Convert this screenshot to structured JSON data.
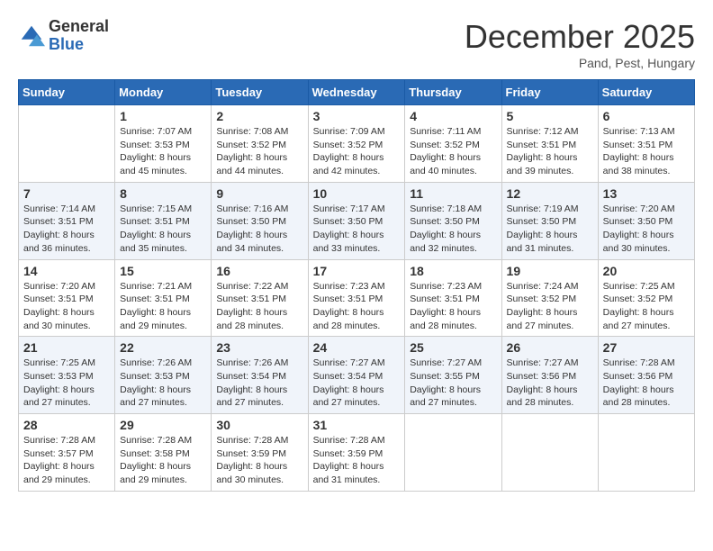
{
  "logo": {
    "general": "General",
    "blue": "Blue"
  },
  "title": "December 2025",
  "location": "Pand, Pest, Hungary",
  "days_header": [
    "Sunday",
    "Monday",
    "Tuesday",
    "Wednesday",
    "Thursday",
    "Friday",
    "Saturday"
  ],
  "weeks": [
    [
      {
        "day": "",
        "info": ""
      },
      {
        "day": "1",
        "info": "Sunrise: 7:07 AM\nSunset: 3:53 PM\nDaylight: 8 hours\nand 45 minutes."
      },
      {
        "day": "2",
        "info": "Sunrise: 7:08 AM\nSunset: 3:52 PM\nDaylight: 8 hours\nand 44 minutes."
      },
      {
        "day": "3",
        "info": "Sunrise: 7:09 AM\nSunset: 3:52 PM\nDaylight: 8 hours\nand 42 minutes."
      },
      {
        "day": "4",
        "info": "Sunrise: 7:11 AM\nSunset: 3:52 PM\nDaylight: 8 hours\nand 40 minutes."
      },
      {
        "day": "5",
        "info": "Sunrise: 7:12 AM\nSunset: 3:51 PM\nDaylight: 8 hours\nand 39 minutes."
      },
      {
        "day": "6",
        "info": "Sunrise: 7:13 AM\nSunset: 3:51 PM\nDaylight: 8 hours\nand 38 minutes."
      }
    ],
    [
      {
        "day": "7",
        "info": "Sunrise: 7:14 AM\nSunset: 3:51 PM\nDaylight: 8 hours\nand 36 minutes."
      },
      {
        "day": "8",
        "info": "Sunrise: 7:15 AM\nSunset: 3:51 PM\nDaylight: 8 hours\nand 35 minutes."
      },
      {
        "day": "9",
        "info": "Sunrise: 7:16 AM\nSunset: 3:50 PM\nDaylight: 8 hours\nand 34 minutes."
      },
      {
        "day": "10",
        "info": "Sunrise: 7:17 AM\nSunset: 3:50 PM\nDaylight: 8 hours\nand 33 minutes."
      },
      {
        "day": "11",
        "info": "Sunrise: 7:18 AM\nSunset: 3:50 PM\nDaylight: 8 hours\nand 32 minutes."
      },
      {
        "day": "12",
        "info": "Sunrise: 7:19 AM\nSunset: 3:50 PM\nDaylight: 8 hours\nand 31 minutes."
      },
      {
        "day": "13",
        "info": "Sunrise: 7:20 AM\nSunset: 3:50 PM\nDaylight: 8 hours\nand 30 minutes."
      }
    ],
    [
      {
        "day": "14",
        "info": "Sunrise: 7:20 AM\nSunset: 3:51 PM\nDaylight: 8 hours\nand 30 minutes."
      },
      {
        "day": "15",
        "info": "Sunrise: 7:21 AM\nSunset: 3:51 PM\nDaylight: 8 hours\nand 29 minutes."
      },
      {
        "day": "16",
        "info": "Sunrise: 7:22 AM\nSunset: 3:51 PM\nDaylight: 8 hours\nand 28 minutes."
      },
      {
        "day": "17",
        "info": "Sunrise: 7:23 AM\nSunset: 3:51 PM\nDaylight: 8 hours\nand 28 minutes."
      },
      {
        "day": "18",
        "info": "Sunrise: 7:23 AM\nSunset: 3:51 PM\nDaylight: 8 hours\nand 28 minutes."
      },
      {
        "day": "19",
        "info": "Sunrise: 7:24 AM\nSunset: 3:52 PM\nDaylight: 8 hours\nand 27 minutes."
      },
      {
        "day": "20",
        "info": "Sunrise: 7:25 AM\nSunset: 3:52 PM\nDaylight: 8 hours\nand 27 minutes."
      }
    ],
    [
      {
        "day": "21",
        "info": "Sunrise: 7:25 AM\nSunset: 3:53 PM\nDaylight: 8 hours\nand 27 minutes."
      },
      {
        "day": "22",
        "info": "Sunrise: 7:26 AM\nSunset: 3:53 PM\nDaylight: 8 hours\nand 27 minutes."
      },
      {
        "day": "23",
        "info": "Sunrise: 7:26 AM\nSunset: 3:54 PM\nDaylight: 8 hours\nand 27 minutes."
      },
      {
        "day": "24",
        "info": "Sunrise: 7:27 AM\nSunset: 3:54 PM\nDaylight: 8 hours\nand 27 minutes."
      },
      {
        "day": "25",
        "info": "Sunrise: 7:27 AM\nSunset: 3:55 PM\nDaylight: 8 hours\nand 27 minutes."
      },
      {
        "day": "26",
        "info": "Sunrise: 7:27 AM\nSunset: 3:56 PM\nDaylight: 8 hours\nand 28 minutes."
      },
      {
        "day": "27",
        "info": "Sunrise: 7:28 AM\nSunset: 3:56 PM\nDaylight: 8 hours\nand 28 minutes."
      }
    ],
    [
      {
        "day": "28",
        "info": "Sunrise: 7:28 AM\nSunset: 3:57 PM\nDaylight: 8 hours\nand 29 minutes."
      },
      {
        "day": "29",
        "info": "Sunrise: 7:28 AM\nSunset: 3:58 PM\nDaylight: 8 hours\nand 29 minutes."
      },
      {
        "day": "30",
        "info": "Sunrise: 7:28 AM\nSunset: 3:59 PM\nDaylight: 8 hours\nand 30 minutes."
      },
      {
        "day": "31",
        "info": "Sunrise: 7:28 AM\nSunset: 3:59 PM\nDaylight: 8 hours\nand 31 minutes."
      },
      {
        "day": "",
        "info": ""
      },
      {
        "day": "",
        "info": ""
      },
      {
        "day": "",
        "info": ""
      }
    ]
  ]
}
